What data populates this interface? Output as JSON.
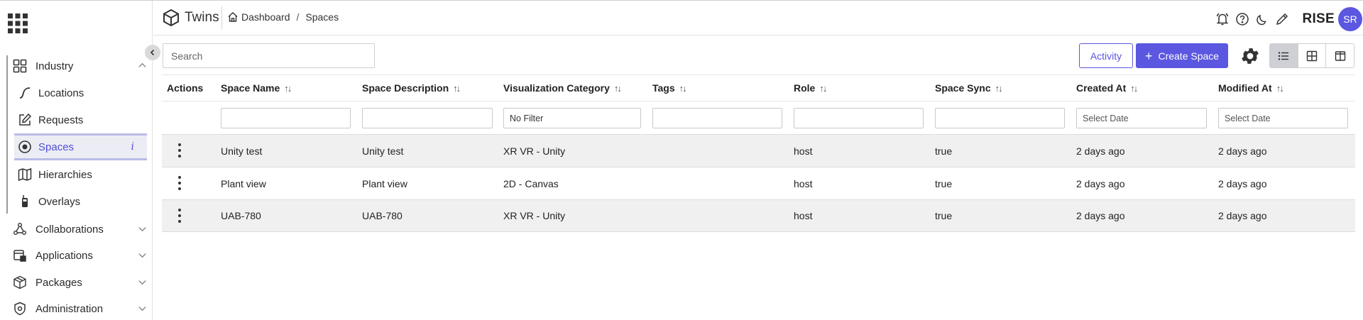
{
  "app": {
    "name": "Twins",
    "org": "RISE",
    "avatar_initials": "SR"
  },
  "breadcrumb": {
    "home": "Dashboard",
    "separator": "/",
    "current": "Spaces"
  },
  "colors": {
    "accent": "#5b57e0",
    "active_bg": "#ececf5",
    "row_shade": "#f0f0f0"
  },
  "sidebar": {
    "groups": [
      {
        "label": "Industry",
        "icon": "dashboard-grid-icon",
        "expanded": true
      },
      {
        "label": "Collaborations",
        "icon": "network-icon",
        "expanded": false
      },
      {
        "label": "Applications",
        "icon": "applications-icon",
        "expanded": false
      },
      {
        "label": "Packages",
        "icon": "package-icon",
        "expanded": false
      },
      {
        "label": "Administration",
        "icon": "shield-gear-icon",
        "expanded": false
      }
    ],
    "industry_items": [
      {
        "label": "Locations",
        "icon": "route-icon"
      },
      {
        "label": "Requests",
        "icon": "edit-square-icon"
      },
      {
        "label": "Spaces",
        "icon": "target-icon",
        "active": true,
        "info": "i"
      },
      {
        "label": "Hierarchies",
        "icon": "map-icon"
      },
      {
        "label": "Overlays",
        "icon": "walkie-talkie-icon"
      }
    ]
  },
  "toolbar": {
    "search_placeholder": "Search",
    "activity_label": "Activity",
    "create_label": "Create Space",
    "create_plus": "+"
  },
  "table": {
    "headers": [
      "Actions",
      "Space Name",
      "Space Description",
      "Visualization Category",
      "Tags",
      "Role",
      "Space Sync",
      "Created At",
      "Modified At"
    ],
    "sort_glyph": "↑↓",
    "filters": {
      "visualization_category": "No Filter",
      "created_at_placeholder": "Select Date",
      "modified_at_placeholder": "Select Date"
    },
    "rows": [
      {
        "name": "Unity test",
        "description": "Unity test",
        "category": "XR VR - Unity",
        "tags": "",
        "role": "host",
        "sync": "true",
        "created": "2 days ago",
        "modified": "2 days ago"
      },
      {
        "name": "Plant view",
        "description": "Plant view",
        "category": "2D - Canvas",
        "tags": "",
        "role": "host",
        "sync": "true",
        "created": "2 days ago",
        "modified": "2 days ago"
      },
      {
        "name": "UAB-780",
        "description": "UAB-780",
        "category": "XR VR - Unity",
        "tags": "",
        "role": "host",
        "sync": "true",
        "created": "2 days ago",
        "modified": "2 days ago"
      }
    ]
  }
}
